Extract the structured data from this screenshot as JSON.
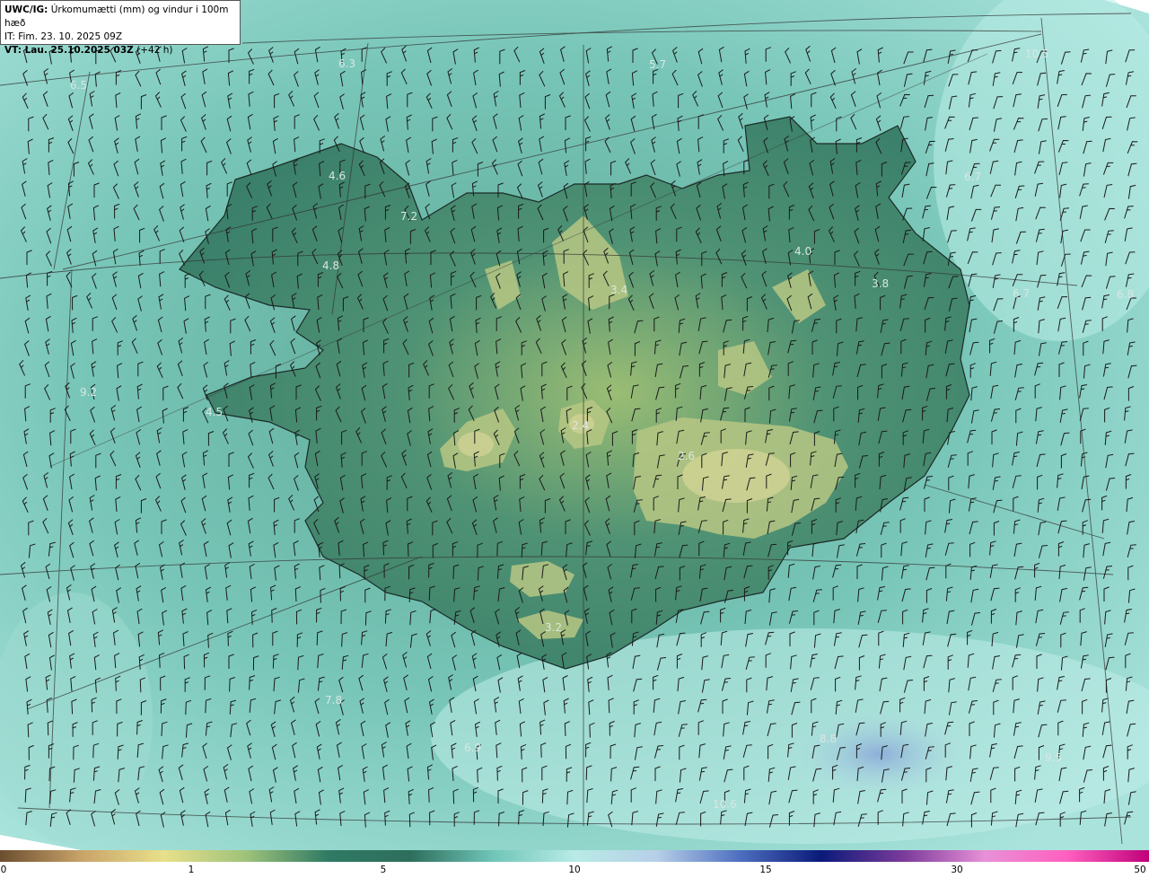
{
  "header": {
    "model": "UWC/IG:",
    "description": "Úrkomumætti (mm) og vindur i 100m hæð",
    "initial_time": "IT: Fim. 23. 10. 2025 09Z",
    "valid_prefix": "VT: Lau. 25.10.2025 03Z",
    "valid_offset": "(+42 h)"
  },
  "value_labels": [
    "6.5",
    "6.3",
    "5.7",
    "10.5",
    "4.6",
    "7.2",
    "6.7",
    "4.0",
    "4.8",
    "3.4",
    "3.8",
    "6.7",
    "6.8",
    "9.2",
    "4.5",
    "2.4",
    "2.6",
    "3.2",
    "7.8",
    "6.9",
    "8.8",
    "9.5",
    "10.6"
  ],
  "colorbar": {
    "ticks": [
      "0",
      "1",
      "5",
      "10",
      "15",
      "30",
      "50"
    ],
    "colors": [
      "#6b4e2e",
      "#c9a46a",
      "#e8e08a",
      "#9ec27a",
      "#2f7a64",
      "#2e6e5c",
      "#6fc5b8",
      "#b8ebe6",
      "#b7cfe8",
      "#4f70c0",
      "#0a1a7a",
      "#7a3a9a",
      "#e890d8",
      "#ff60c0",
      "#c0007a"
    ]
  }
}
